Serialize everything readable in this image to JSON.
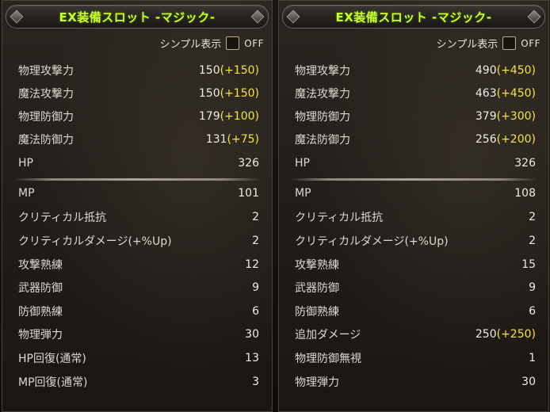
{
  "colors": {
    "title": "#c6ff2a",
    "bonus": "#f3e53a",
    "text": "#ddd8d0"
  },
  "icons": [
    "checkbox-icon",
    "title-knob-icon"
  ],
  "panels": [
    {
      "title": "EX装備スロット -マジック-",
      "simple_label": "シンプル表示",
      "simple_state": "OFF",
      "stats": [
        {
          "label": "物理攻撃力",
          "value": "150",
          "bonus": "(+150)"
        },
        {
          "label": "魔法攻撃力",
          "value": "150",
          "bonus": "(+150)"
        },
        {
          "label": "物理防御力",
          "value": "179",
          "bonus": "(+100)"
        },
        {
          "label": "魔法防御力",
          "value": "131",
          "bonus": "(+75)"
        },
        {
          "label": "HP",
          "value": "326",
          "bonus": ""
        },
        {
          "label": "MP",
          "value": "101",
          "bonus": ""
        },
        {
          "label": "クリティカル抵抗",
          "value": "2",
          "bonus": ""
        },
        {
          "label": "クリティカルダメージ(+%Up)",
          "value": "2",
          "bonus": ""
        },
        {
          "label": "攻撃熟練",
          "value": "12",
          "bonus": ""
        },
        {
          "label": "武器防御",
          "value": "9",
          "bonus": ""
        },
        {
          "label": "防御熟練",
          "value": "6",
          "bonus": ""
        },
        {
          "label": "物理弾力",
          "value": "30",
          "bonus": ""
        },
        {
          "label": "HP回復(通常)",
          "value": "13",
          "bonus": ""
        },
        {
          "label": "MP回復(通常)",
          "value": "3",
          "bonus": ""
        }
      ]
    },
    {
      "title": "EX装備スロット -マジック-",
      "simple_label": "シンプル表示",
      "simple_state": "OFF",
      "stats": [
        {
          "label": "物理攻撃力",
          "value": "490",
          "bonus": "(+450)"
        },
        {
          "label": "魔法攻撃力",
          "value": "463",
          "bonus": "(+450)"
        },
        {
          "label": "物理防御力",
          "value": "379",
          "bonus": "(+300)"
        },
        {
          "label": "魔法防御力",
          "value": "256",
          "bonus": "(+200)"
        },
        {
          "label": "HP",
          "value": "326",
          "bonus": ""
        },
        {
          "label": "MP",
          "value": "108",
          "bonus": ""
        },
        {
          "label": "クリティカル抵抗",
          "value": "2",
          "bonus": ""
        },
        {
          "label": "クリティカルダメージ(+%Up)",
          "value": "2",
          "bonus": ""
        },
        {
          "label": "攻撃熟練",
          "value": "15",
          "bonus": ""
        },
        {
          "label": "武器防御",
          "value": "9",
          "bonus": ""
        },
        {
          "label": "防御熟練",
          "value": "6",
          "bonus": ""
        },
        {
          "label": "追加ダメージ",
          "value": "250",
          "bonus": "(+250)"
        },
        {
          "label": "物理防御無視",
          "value": "1",
          "bonus": ""
        },
        {
          "label": "物理弾力",
          "value": "30",
          "bonus": ""
        }
      ]
    }
  ]
}
